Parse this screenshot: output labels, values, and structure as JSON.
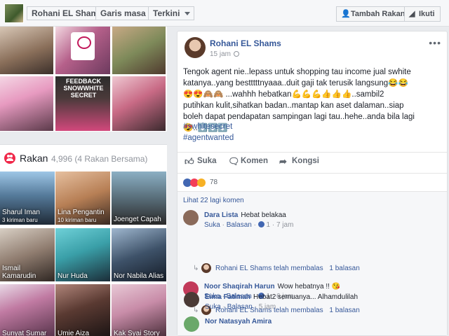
{
  "topbar": {
    "profile_name": "Rohani EL Shams",
    "timeline_label": "Garis masa",
    "latest_label": "Terkini",
    "add_friend_label": "Tambah Rakan",
    "follow_label": "Ikuti"
  },
  "photos": {
    "feedback_caption": "FEEDBACK SNOWWHITE SECRET"
  },
  "friends": {
    "title": "Rakan",
    "count": "4,996 (4 Rakan Bersama)",
    "items": [
      {
        "name": "Sharul Iman",
        "sub": "3 kiriman baru"
      },
      {
        "name": "Lina Pengantin",
        "sub": "10 kiriman baru"
      },
      {
        "name": "Joenget Capah",
        "sub": ""
      },
      {
        "name": "Ismail Kamarudin",
        "sub": ""
      },
      {
        "name": "Nur Huda",
        "sub": ""
      },
      {
        "name": "Nor Nabila Alias",
        "sub": ""
      },
      {
        "name": "Sunyat Sumar",
        "sub": ""
      },
      {
        "name": "Umie Aiza",
        "sub": ""
      },
      {
        "name": "Kak Syai Story",
        "sub": ""
      }
    ]
  },
  "post": {
    "author": "Rohani EL Shams",
    "time": "15 jam",
    "text": "Tengok agent nie..lepass untuk shopping tau income jual swhite katanya..yang bestttttnyaaa..duit gaji tak terusik langsung😂😂😍😍🙈🙈 ...wahhh hebatkan💪💪💪👍👍👍..sambil2 putihkan kulit,sihatkan badan..mantap kan aset dalaman..siap boleh dapat pendapatan sampingan lagi tau..hehe..anda bila lagi😍..⬇️⬇️⬇️",
    "tags": [
      "#swhitesecret",
      "#agentwanted"
    ],
    "actions": {
      "like": "Suka",
      "comment": "Komen",
      "share": "Kongsi"
    },
    "reaction_count": "78",
    "more_comments": "Lihat 22 lagi komen",
    "comments": [
      {
        "name": "Dara Lista",
        "text": "Hebat belakaa",
        "like": "Suka",
        "reply": "Balasan",
        "likes": "1",
        "time": "7 jam",
        "reply_text": "Rohani EL Shams telah membalas",
        "reply_count": "1 balasan",
        "color": "#8a6a5a"
      },
      {
        "name": "Noor Shaqirah Harun",
        "text": "Wow hebatnya !! 😘",
        "like": "Suka",
        "reply": "Balasan",
        "likes": "1",
        "time": "6 jam",
        "reply_text": "Rohani EL Shams telah membalas",
        "reply_count": "1 balasan",
        "color": "#c23a5a"
      },
      {
        "name": "Eima Fatimah",
        "text": "Hebat2 semuanya... Alhamdulilah",
        "like": "Suka",
        "reply": "Balasan",
        "likes": "",
        "time": "5 jam",
        "reply_text": "",
        "reply_count": "",
        "color": "#4a3a36"
      },
      {
        "name": "Nor Natasyah Amira",
        "text": "",
        "like": "",
        "reply": "",
        "likes": "",
        "time": "",
        "reply_text": "",
        "reply_count": "",
        "color": "#6aa86a"
      }
    ]
  },
  "colors": {
    "link": "#365899",
    "brand": "#4267b2"
  }
}
